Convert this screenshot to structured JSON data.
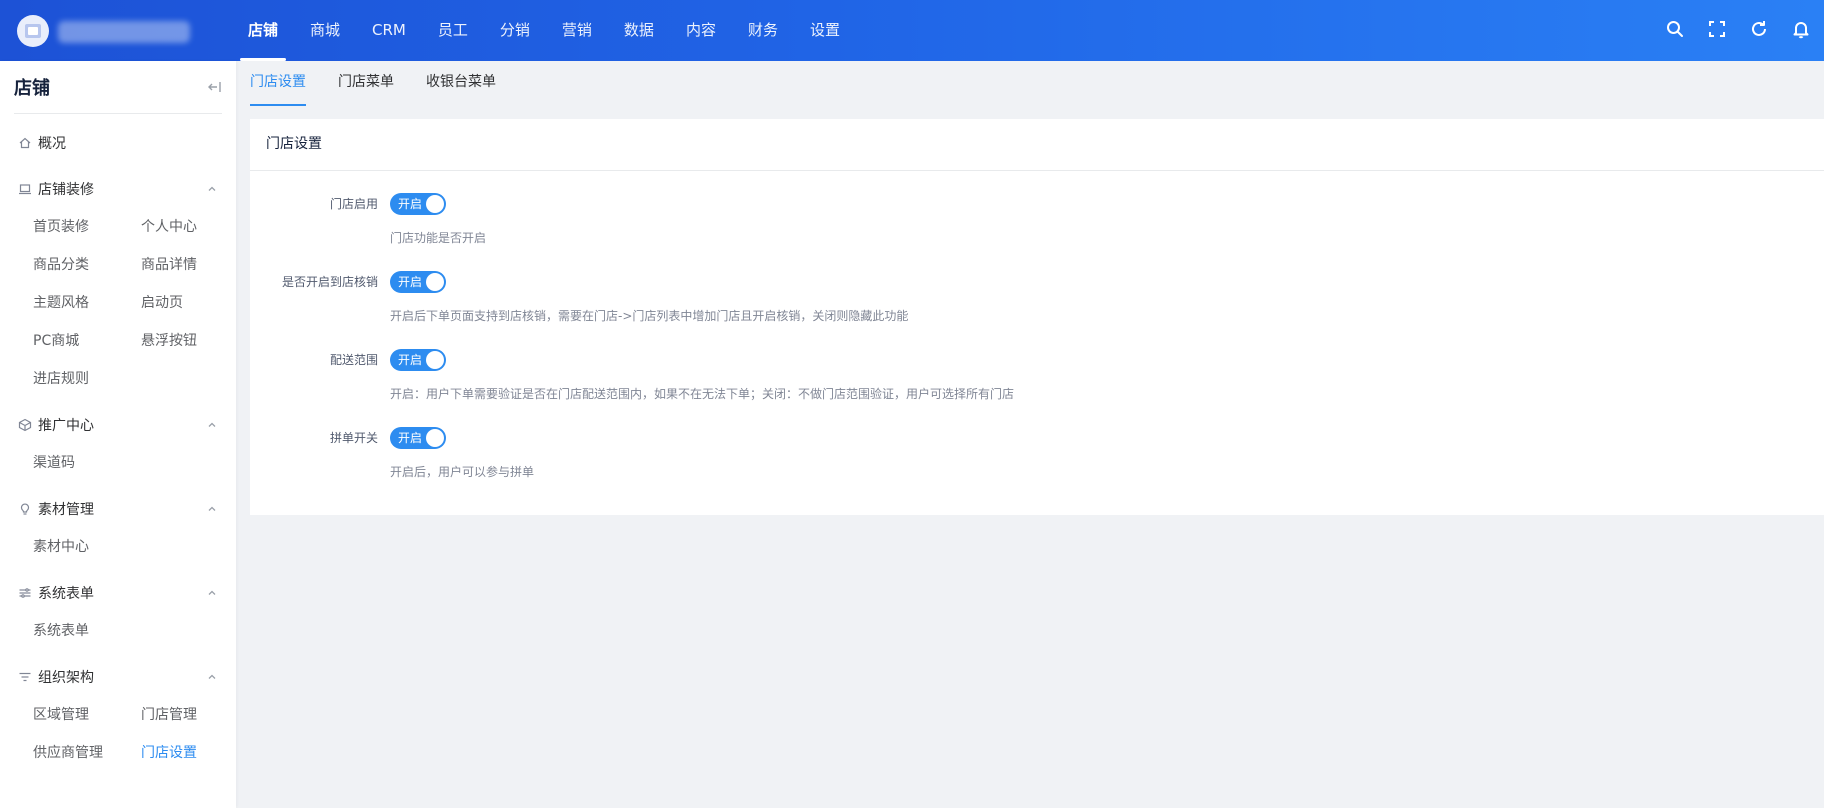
{
  "topnav": {
    "items": [
      {
        "label": "店铺",
        "active": true
      },
      {
        "label": "商城"
      },
      {
        "label": "CRM"
      },
      {
        "label": "员工"
      },
      {
        "label": "分销"
      },
      {
        "label": "营销"
      },
      {
        "label": "数据"
      },
      {
        "label": "内容"
      },
      {
        "label": "财务"
      },
      {
        "label": "设置"
      }
    ],
    "icons": [
      "search-icon",
      "fullscreen-icon",
      "refresh-icon",
      "bell-icon"
    ]
  },
  "sidebar": {
    "title": "店铺",
    "overview": "概况",
    "groups": [
      {
        "title": "店铺装修",
        "icon": "laptop-icon",
        "items": [
          "首页装修",
          "个人中心",
          "商品分类",
          "商品详情",
          "主题风格",
          "启动页",
          "PC商城",
          "悬浮按钮",
          "进店规则"
        ]
      },
      {
        "title": "推广中心",
        "icon": "cube-icon",
        "items": [
          "渠道码"
        ]
      },
      {
        "title": "素材管理",
        "icon": "bulb-icon",
        "items": [
          "素材中心"
        ]
      },
      {
        "title": "系统表单",
        "icon": "sliders-icon",
        "items": [
          "系统表单"
        ]
      },
      {
        "title": "组织架构",
        "icon": "filter-icon",
        "items": [
          "区域管理",
          "门店管理",
          "供应商管理",
          "门店设置"
        ],
        "active_item": "门店设置"
      }
    ]
  },
  "tabs": [
    {
      "label": "门店设置",
      "active": true
    },
    {
      "label": "门店菜单"
    },
    {
      "label": "收银台菜单"
    }
  ],
  "card": {
    "title": "门店设置",
    "rows": [
      {
        "label": "门店启用",
        "switch_text": "开启",
        "on": true,
        "desc": "门店功能是否开启"
      },
      {
        "label": "是否开启到店核销",
        "switch_text": "开启",
        "on": true,
        "desc": "开启后下单页面支持到店核销，需要在门店->门店列表中增加门店且开启核销，关闭则隐藏此功能"
      },
      {
        "label": "配送范围",
        "switch_text": "开启",
        "on": true,
        "desc": "开启：用户下单需要验证是否在门店配送范围内，如果不在无法下单；关闭：不做门店范围验证，用户可选择所有门店"
      },
      {
        "label": "拼单开关",
        "switch_text": "开启",
        "on": true,
        "desc": "开启后，用户可以参与拼单"
      }
    ]
  },
  "colors": {
    "primary": "#2d8cf0",
    "topbar_start": "#1d52d6",
    "topbar_end": "#2a80f5"
  }
}
